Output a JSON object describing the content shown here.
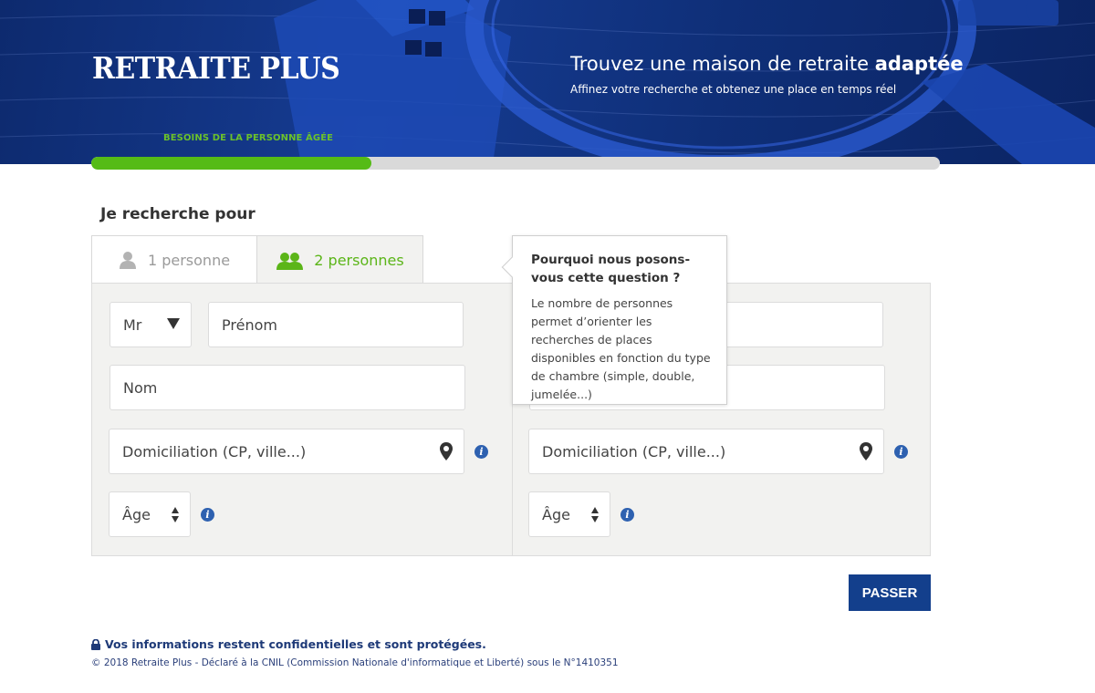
{
  "header": {
    "logo_text": "RETRAITE PLUS",
    "tagline_prefix": "Trouvez une maison de retraite ",
    "tagline_bold": "adaptée",
    "subtagline": "Affinez votre recherche et obtenez une place en temps réel",
    "step_label": "BESOINS DE LA PERSONNE ÂGÉE",
    "progress_percent": 33
  },
  "section": {
    "title": "Je recherche pour",
    "tabs": [
      {
        "label": "1 personne",
        "icon": "person-icon",
        "active": false
      },
      {
        "label": "2 personnes",
        "icon": "people-icon",
        "active": true
      }
    ]
  },
  "form": {
    "person1": {
      "civility": "Mr",
      "firstname_placeholder": "Prénom",
      "lastname_placeholder": "Nom",
      "domicile_placeholder": "Domiciliation (CP, ville...)",
      "age_placeholder": "Âge"
    },
    "person2": {
      "domicile_placeholder": "Domiciliation (CP, ville...)",
      "age_placeholder": "Âge"
    }
  },
  "tooltip": {
    "title": "Pourquoi nous posons-vous cette question ?",
    "body": "Le nombre de personnes permet d’orienter les recherches de places disponibles en fonction du type de chambre (simple, double, jumelée...)"
  },
  "actions": {
    "skip_label": "PASSER"
  },
  "footer": {
    "confidential": "Vos informations restent confidentielles et sont protégées.",
    "copyright": "© 2018 Retraite Plus - Déclaré à la CNIL (Commission Nationale d'informatique et Liberté) sous le N°1410351"
  },
  "colors": {
    "brand_blue": "#133f8c",
    "accent_green": "#55bb16",
    "info_blue": "#2e61b0"
  }
}
